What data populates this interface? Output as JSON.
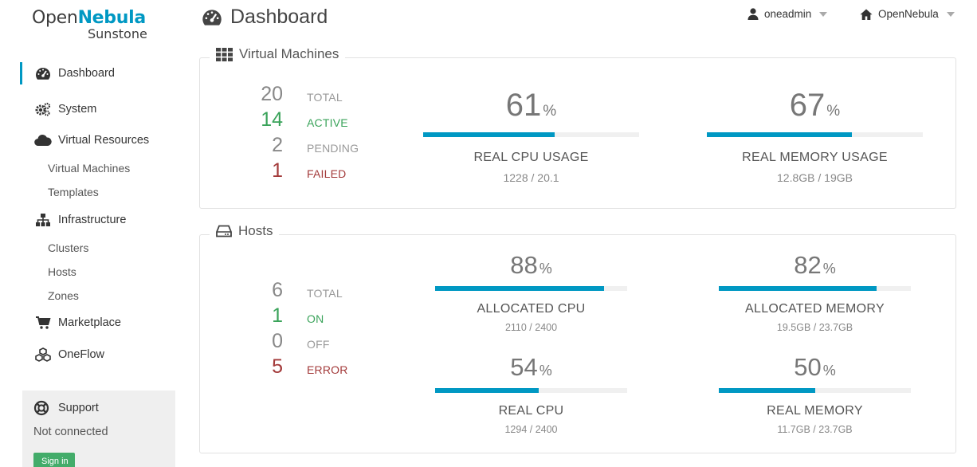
{
  "logo": {
    "open": "Open",
    "nebula": "Nebula",
    "sunstone": "Sunstone"
  },
  "sidebar": {
    "items": [
      {
        "label": "Dashboard",
        "icon": "tachometer-icon",
        "active": true
      },
      {
        "label": "System",
        "icon": "cogs-icon"
      },
      {
        "label": "Virtual Resources",
        "icon": "cloud-icon",
        "children": [
          "Virtual Machines",
          "Templates"
        ]
      },
      {
        "label": "Infrastructure",
        "icon": "sitemap-icon",
        "children": [
          "Clusters",
          "Hosts",
          "Zones"
        ]
      },
      {
        "label": "Marketplace",
        "icon": "shopping-cart-icon"
      },
      {
        "label": "OneFlow",
        "icon": "cubes-icon"
      }
    ],
    "support": {
      "label": "Support",
      "status": "Not connected",
      "signin": "Sign in"
    }
  },
  "header": {
    "title": "Dashboard",
    "user": "oneadmin",
    "zone": "OpenNebula"
  },
  "vms": {
    "legend": "Virtual Machines",
    "stats": [
      {
        "num": "20",
        "label": "TOTAL",
        "status": "grey"
      },
      {
        "num": "14",
        "label": "ACTIVE",
        "status": "green"
      },
      {
        "num": "2",
        "label": "PENDING",
        "status": "grey"
      },
      {
        "num": "1",
        "label": "FAILED",
        "status": "red"
      }
    ],
    "cpu": {
      "pct": "61",
      "fraction": 0.61,
      "title": "REAL CPU USAGE",
      "sub": "1228 / 20.1"
    },
    "mem": {
      "pct": "67",
      "fraction": 0.67,
      "title": "REAL MEMORY USAGE",
      "sub": "12.8GB / 19GB"
    }
  },
  "hosts": {
    "legend": "Hosts",
    "stats": [
      {
        "num": "6",
        "label": "TOTAL",
        "status": "grey"
      },
      {
        "num": "1",
        "label": "ON",
        "status": "green"
      },
      {
        "num": "0",
        "label": "OFF",
        "status": "grey"
      },
      {
        "num": "5",
        "label": "ERROR",
        "status": "red"
      }
    ],
    "alloc_cpu": {
      "pct": "88",
      "fraction": 0.88,
      "title": "ALLOCATED CPU",
      "sub": "2110 / 2400"
    },
    "alloc_mem": {
      "pct": "82",
      "fraction": 0.82,
      "title": "ALLOCATED MEMORY",
      "sub": "19.5GB / 23.7GB"
    },
    "real_cpu": {
      "pct": "54",
      "fraction": 0.54,
      "title": "REAL CPU",
      "sub": "1294 / 2400"
    },
    "real_mem": {
      "pct": "50",
      "fraction": 0.5,
      "title": "REAL MEMORY",
      "sub": "11.7GB / 23.7GB"
    }
  },
  "colors": {
    "accent": "#0098c3",
    "ok": "#3aa35a",
    "error": "#a33a3a",
    "signin": "#43ac6a"
  },
  "pct_symbol": "%"
}
